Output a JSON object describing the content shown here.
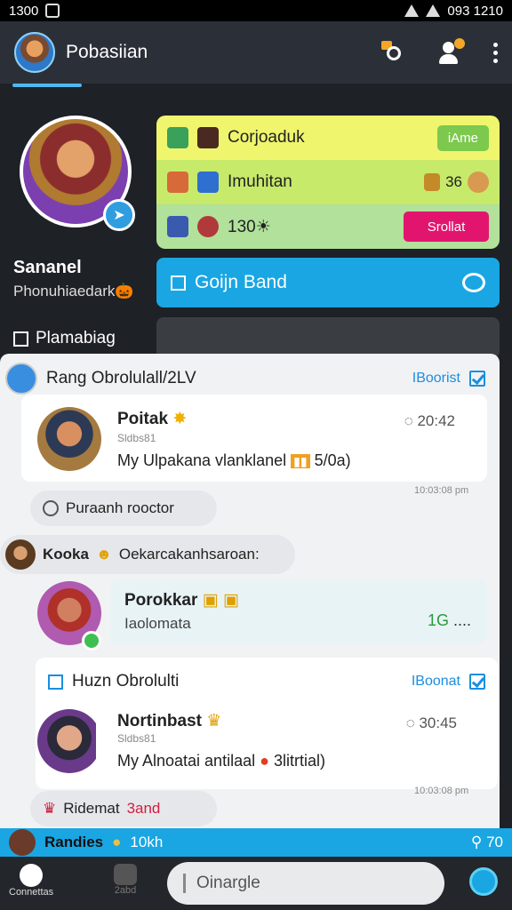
{
  "status_bar": {
    "time_left": "1300",
    "time_right": "093 1210"
  },
  "app_bar": {
    "title": "Pobasiian"
  },
  "profile": {
    "name": "Sananel",
    "subtitle": "Phonuhiaedark",
    "sub_emoji": "🎃",
    "badge_icon": "➤",
    "playback_label": "Plamabiag"
  },
  "status_rows": [
    {
      "label": "Corjoaduk",
      "pill": "iAme"
    },
    {
      "label": "Imuhitan",
      "extra": "36"
    },
    {
      "label": "130",
      "suffix": "☀",
      "pill": "Srollat"
    }
  ],
  "join_button": {
    "label": "Goijn Band"
  },
  "feed": {
    "post1": {
      "header": "Rang Obrolulall/2LV",
      "boost": "IBoorist",
      "author": "Poitak",
      "author_badge": "✸",
      "meta": "Sldbs81",
      "text": "My Ulpakana vlanklanel",
      "tag": "5/0a)",
      "time": "20:42",
      "footer_time": "10:03:08 pm",
      "reaction": "Puraanh rooctor"
    },
    "inline_chat": {
      "author": "Kooka",
      "text": "Oekarcakanhsaroan:"
    },
    "post2": {
      "author": "Porokkar",
      "sub": "Iaolomata",
      "count": "1G",
      "dots": "...."
    },
    "post3": {
      "header": "Huzn Obrolulti",
      "boost": "IBoonat",
      "author": "Nortinbast",
      "meta": "Sldbs81",
      "text": "My Alnoatai antilaal",
      "tag": "3litrtial)",
      "time": "30:45",
      "footer_time": "10:03:08 pm",
      "reaction_prefix": "Ridemat",
      "reaction_suffix": "3and"
    }
  },
  "ribbon": {
    "label": "Randies",
    "extra": "10kh",
    "count": "70"
  },
  "bottom_nav": {
    "home_label": "Connettas",
    "second_label": "2abd",
    "compose_placeholder": "Oinargle"
  },
  "colors": {
    "accent": "#1aa6e2",
    "yellow_row": "#eff56d",
    "green_row": "#c7ea6a",
    "pink_pill": "#e2156e"
  }
}
